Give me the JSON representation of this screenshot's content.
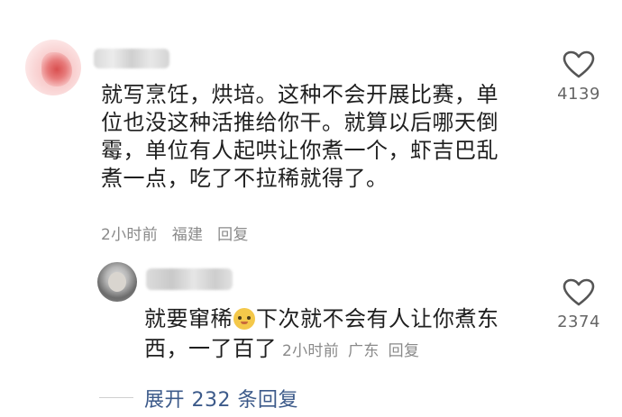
{
  "comment": {
    "text": "就写烹饪，烘培。这种不会开展比赛，单位也没这种活推给你干。就算以后哪天倒霉，单位有人起哄让你煮一个，虾吉巴乱煮一点，吃了不拉稀就得了。",
    "time": "2小时前",
    "location": "福建",
    "reply_label": "回复",
    "like_count": "4139",
    "like_icon": "heart-outline-icon"
  },
  "reply": {
    "text_before_emoji": "就要窜稀",
    "emoji": "smiling-face-emoji",
    "text_after_emoji": "下次就不会有人让你煮东西，一了百了",
    "time": "2小时前",
    "location": "广东",
    "reply_label": "回复",
    "like_count": "2374",
    "like_icon": "heart-outline-icon"
  },
  "expand_replies": {
    "label": "展开 232 条回复"
  },
  "colors": {
    "text": "#1f1f1f",
    "meta": "#8a8a8a",
    "link": "#3c5a8a",
    "heart": "#555555"
  }
}
